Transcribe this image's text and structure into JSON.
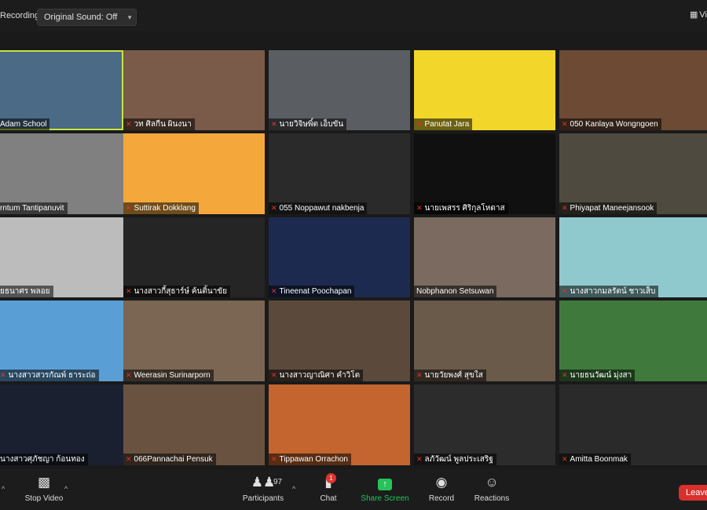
{
  "topbar": {
    "recording_label": "Recording",
    "sound_label": "Original Sound: Off",
    "view_label": "Vi"
  },
  "participants": [
    {
      "name": "Adam School",
      "muted": false,
      "active": true,
      "bg": "#4a6a85"
    },
    {
      "name": "วท ศิลกีน ผินงนา",
      "muted": true,
      "bg": "#7a5a48"
    },
    {
      "name": "นายวิจิษพิ์ต เอ็บขัน",
      "muted": true,
      "bg": "#5a5d62"
    },
    {
      "name": "Panutat Jara",
      "muted": true,
      "bg": "#f2d72a"
    },
    {
      "name": "050 Kanlaya Wongngoen",
      "muted": true,
      "bg": "#6d4a33"
    },
    {
      "name": "rntum Tantipanuvit",
      "muted": false,
      "bg": "#808080"
    },
    {
      "name": "Suttirak Dokklang",
      "muted": true,
      "bg": "#f4a83c"
    },
    {
      "name": "055 Noppawut nakbenja",
      "muted": true,
      "bg": "#2a2a2a"
    },
    {
      "name": "นายเพสรร ศิริกุลโหดาส",
      "muted": true,
      "bg": "#101010"
    },
    {
      "name": "Phiyapat Maneejansook",
      "muted": true,
      "bg": "#4f4a3f"
    },
    {
      "name": "ยธนาศร พลอย",
      "muted": false,
      "bg": "#bcbcbc"
    },
    {
      "name": "นางสาวกี้สุธาร์ษ์ ค้นติ้นาขัย",
      "muted": true,
      "bg": "#252525"
    },
    {
      "name": "Tineenat Poochapan",
      "muted": true,
      "bg": "#1c2a50"
    },
    {
      "name": "Nobphanon Setsuwan",
      "muted": false,
      "bg": "#7a6a60"
    },
    {
      "name": "นางสาวกมลรัตน์ ชาวเส็บ",
      "muted": true,
      "bg": "#8fc9cd"
    },
    {
      "name": "นางสาวสวรกัณพ์ ธาระถ่อ",
      "muted": true,
      "bg": "#5a9ed6"
    },
    {
      "name": "Weerasin Surinarporn",
      "muted": true,
      "bg": "#7a6652"
    },
    {
      "name": "นางสาวญาณิศา คำวิโต",
      "muted": true,
      "bg": "#5b4a3c"
    },
    {
      "name": "นายวัยพงศ์ สุขใส",
      "muted": true,
      "bg": "#6a5a4a"
    },
    {
      "name": "นายธนวัฒน์ มุ่งสา",
      "muted": true,
      "bg": "#3f7a3c"
    },
    {
      "name": "นางสาวศุภัชญา ก้อนทอง",
      "muted": false,
      "bg": "#1a2030"
    },
    {
      "name": "066Pannachai Pensuk",
      "muted": true,
      "bg": "#6a5240"
    },
    {
      "name": "Tippawan Orrachon",
      "muted": true,
      "bg": "#c4642e"
    },
    {
      "name": "ลภัวัฒน์ พูลประเสริฐ",
      "muted": true,
      "bg": "#2c2c2c"
    },
    {
      "name": "Amitta Boonmak",
      "muted": true,
      "bg": "#2a2a2a"
    }
  ],
  "toolbar": {
    "stop_video": "Stop Video",
    "participants": "Participants",
    "participant_count": "97",
    "chat": "Chat",
    "chat_badge": "1",
    "share_screen": "Share Screen",
    "record": "Record",
    "reactions": "Reactions",
    "leave": "Leave"
  },
  "colors": {
    "accent_green": "#27c25a",
    "leave_red": "#d9302e",
    "active_speaker": "#c7e63c"
  }
}
